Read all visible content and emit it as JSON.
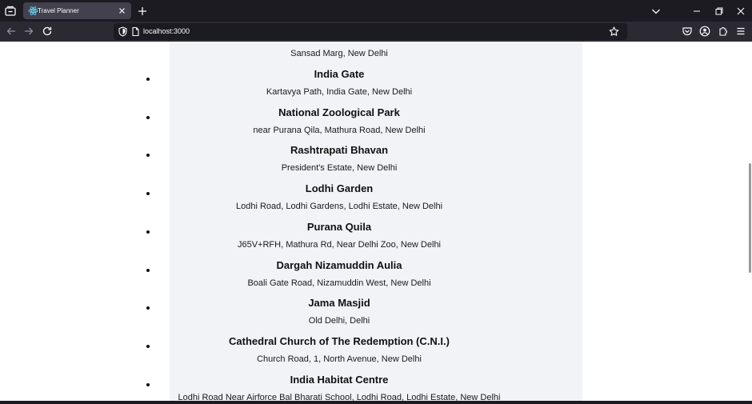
{
  "browser": {
    "tab_title": "Travel Planner",
    "url": "localhost:3000"
  },
  "icons": {
    "tab_list": "tab-list-icon",
    "favicon": "react-logo-icon",
    "tab_close": "close-icon",
    "new_tab": "plus-icon",
    "tab_overflow": "chevron-down-icon",
    "back": "back-arrow-icon",
    "forward": "forward-arrow-icon",
    "reload": "reload-icon",
    "tracking_protection": "shield-icon",
    "page_info": "page-icon",
    "bookmark": "star-icon",
    "pocket": "pocket-icon",
    "account": "account-icon",
    "extensions": "puzzle-icon",
    "menu": "hamburger-menu-icon"
  },
  "page": {
    "first_address": "Sansad Marg, New Delhi",
    "places": [
      {
        "name": "India Gate",
        "address": "Kartavya Path, India Gate, New Delhi"
      },
      {
        "name": "National Zoological Park",
        "address": "near Purana Qila, Mathura Road, New Delhi"
      },
      {
        "name": "Rashtrapati Bhavan",
        "address": "President's Estate, New Delhi"
      },
      {
        "name": "Lodhi Garden",
        "address": "Lodhi Road, Lodhi Gardens, Lodhi Estate, New Delhi"
      },
      {
        "name": "Purana Quila",
        "address": "J65V+RFH, Mathura Rd, Near Delhi Zoo, New Delhi"
      },
      {
        "name": "Dargah Nizamuddin Aulia",
        "address": "Boali Gate Road, Nizamuddin West, New Delhi"
      },
      {
        "name": "Jama Masjid",
        "address": "Old Delhi, Delhi"
      },
      {
        "name": "Cathedral Church of The Redemption (C.N.I.)",
        "address": "Church Road, 1, North Avenue, New Delhi"
      },
      {
        "name": "India Habitat Centre",
        "address": "Lodhi Road Near Airforce Bal Bharati School, Lodhi Road, Lodhi Estate, New Delhi"
      }
    ]
  },
  "colors": {
    "tabbar_bg": "#1c1b22",
    "toolbar_bg": "#2b2a33",
    "active_tab_bg": "#42414d",
    "content_panel_bg": "#f1f3f7",
    "favicon_accent": "#61dafb"
  }
}
